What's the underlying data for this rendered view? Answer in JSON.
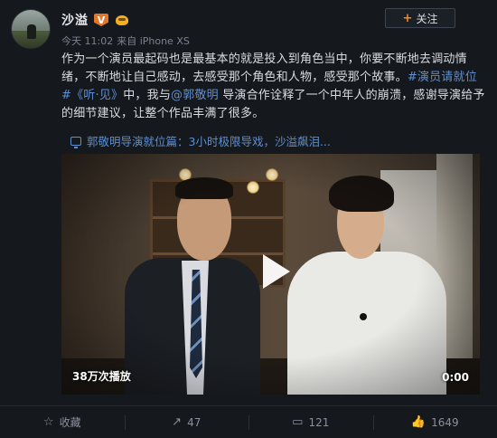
{
  "user": {
    "name": "沙溢",
    "badge": "V",
    "time": "今天 11:02",
    "source": "来自 iPhone XS"
  },
  "follow_button": {
    "plus": "+",
    "label": "关注"
  },
  "post": {
    "line1": "作为一个演员最起码也是最基本的就是投入到角色当中，你要不断地去调动情",
    "line2_a": "绪，不断地让自己感动，去感受那个角色和人物，感受那个故事。",
    "line2_tag": "#演员请就位",
    "line3_tag": "#《听·见》",
    "line3_a": "中，我与",
    "line3_mention": "@郭敬明",
    "line3_b": " 导演合作诠释了一个中年人的崩溃，感谢导演给予",
    "line4": "的细节建议，让整个作品丰满了很多。"
  },
  "video_link": {
    "text": "郭敬明导演就位篇：3小时极限导戏，沙溢飙泪..."
  },
  "video": {
    "play_count": "38万次播放",
    "duration": "0:00"
  },
  "actions": [
    {
      "icon": "☆",
      "label": "收藏"
    },
    {
      "icon": "↗",
      "label": "47"
    },
    {
      "icon": "▭",
      "label": "121"
    },
    {
      "icon": "👍",
      "label": "1649"
    }
  ],
  "colors": {
    "link": "#5d8fd1",
    "accent": "#f08b2c",
    "background": "#15181d"
  }
}
